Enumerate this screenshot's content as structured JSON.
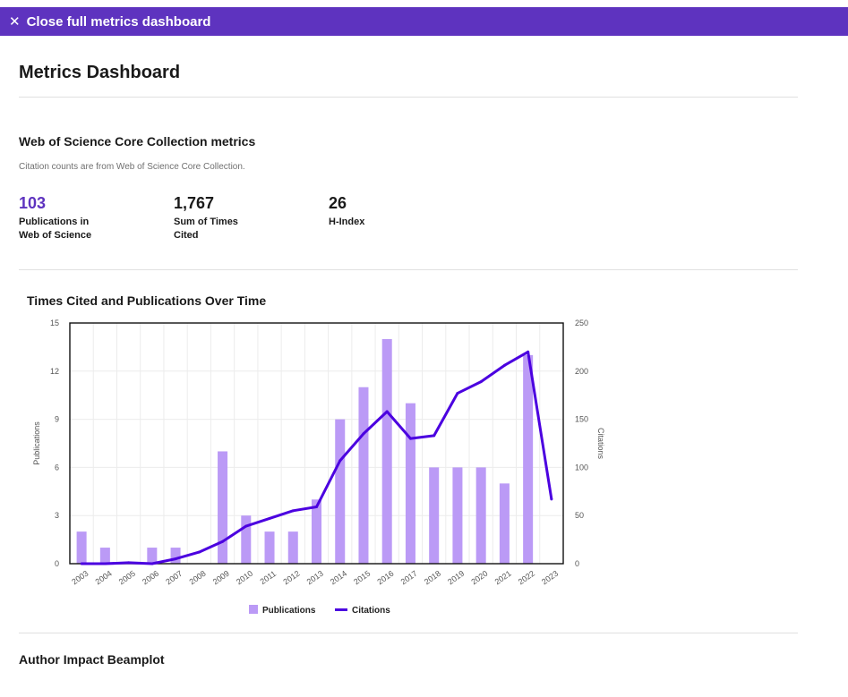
{
  "close_bar": {
    "label": "Close full metrics dashboard",
    "icon": "close-icon"
  },
  "page_title": "Metrics Dashboard",
  "wos": {
    "title": "Web of Science Core Collection metrics",
    "note": "Citation counts are from Web of Science Core Collection.",
    "metrics": [
      {
        "value": "103",
        "label": "Publications in Web of Science"
      },
      {
        "value": "1,767",
        "label": "Sum of Times Cited"
      },
      {
        "value": "26",
        "label": "H-Index"
      }
    ]
  },
  "chart_title": "Times Cited and Publications Over Time",
  "beamplot_title": "Author Impact Beamplot",
  "colors": {
    "accent": "#5e33bf",
    "bar": "#bb9af6",
    "line": "#4b00e0"
  },
  "chart_data": {
    "type": "bar",
    "title": "Times Cited and Publications Over Time",
    "categories": [
      "2003",
      "2004",
      "2005",
      "2006",
      "2007",
      "2008",
      "2009",
      "2010",
      "2011",
      "2012",
      "2013",
      "2014",
      "2015",
      "2016",
      "2017",
      "2018",
      "2019",
      "2020",
      "2021",
      "2022",
      "2023"
    ],
    "series": [
      {
        "name": "Publications",
        "type": "bar",
        "axis": "left",
        "values": [
          2,
          1,
          0,
          1,
          1,
          0,
          7,
          3,
          2,
          2,
          4,
          9,
          11,
          14,
          10,
          6,
          6,
          6,
          5,
          13,
          0
        ]
      },
      {
        "name": "Citations",
        "type": "line",
        "axis": "right",
        "values": [
          0,
          0,
          1,
          0,
          5,
          12,
          23,
          39,
          47,
          55,
          59,
          107,
          135,
          158,
          130,
          133,
          177,
          189,
          206,
          220,
          67
        ]
      }
    ],
    "ylabel": "Publications",
    "y2label": "Citations",
    "ylim": [
      0,
      15
    ],
    "yticks": [
      0,
      3,
      6,
      9,
      12,
      15
    ],
    "y2lim": [
      0,
      250
    ],
    "y2ticks": [
      0,
      50,
      100,
      150,
      200,
      250
    ],
    "grid": true,
    "legend": "bottom"
  }
}
